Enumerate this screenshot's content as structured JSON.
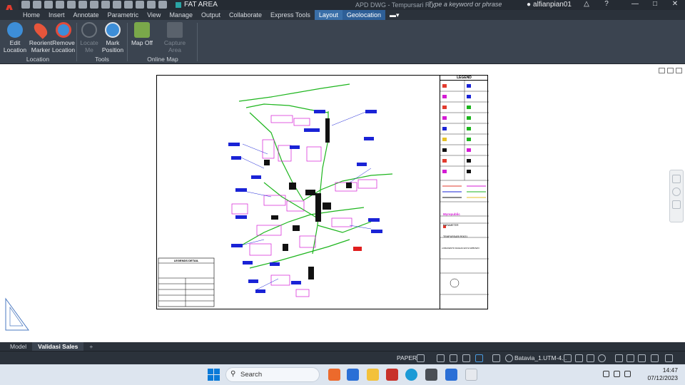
{
  "titlebar": {
    "app_logo": "A",
    "layer_name": "FAT AREA",
    "doc_title": "APD DWG - Tempursari R...",
    "search_placeholder": "Type a keyword or phrase",
    "user": "alfianpian01",
    "help": "?"
  },
  "menu": {
    "tabs": [
      "Home",
      "Insert",
      "Annotate",
      "Parametric",
      "View",
      "Manage",
      "Output",
      "Collaborate",
      "Express Tools",
      "Layout",
      "Geolocation"
    ],
    "active_tabs": [
      "Layout",
      "Geolocation"
    ]
  },
  "ribbon": {
    "groups": [
      {
        "label": "Location",
        "buttons": [
          {
            "label": "Edit\nLocation",
            "icon": "globe-pin-icon",
            "enabled": true
          },
          {
            "label": "Reorient\nMarker",
            "icon": "marker-move-icon",
            "enabled": true
          },
          {
            "label": "Remove\nLocation",
            "icon": "globe-remove-icon",
            "enabled": true
          }
        ]
      },
      {
        "label": "Tools",
        "buttons": [
          {
            "label": "Locate\nMe",
            "icon": "locate-me-icon",
            "enabled": false
          },
          {
            "label": "Mark\nPosition",
            "icon": "mark-position-icon",
            "enabled": true
          }
        ]
      },
      {
        "label": "Online Map",
        "buttons": [
          {
            "label": "Map Off",
            "icon": "map-off-icon",
            "enabled": true
          },
          {
            "label": "Capture\nArea",
            "icon": "capture-area-icon",
            "enabled": false
          }
        ]
      }
    ]
  },
  "drawing": {
    "legend_title": "LEGEND",
    "title_block_label": "PARAMETER",
    "company": "Myrepublic",
    "project": "TEMPURSARI R0021",
    "designer": "LORAVENTO RAIHAN ESYA WIBOWO",
    "table_header": "LEGENDS DETAIL"
  },
  "layout_tabs": [
    "Model",
    "Validasi Sales"
  ],
  "layout_tab_active": "Validasi Sales",
  "layout_tab_add": "+",
  "status": {
    "space": "PAPER",
    "coordinate_system": "Batavia_1.UTM-4..."
  },
  "taskbar": {
    "search_label": "Search",
    "time": "14:47",
    "date": "07/12/2023"
  },
  "colors": {
    "accent": "#3a6fa8",
    "autocad_red": "#e23b2e",
    "road_green": "#1db51d",
    "label_blue": "#1a23d6",
    "parcel_magenta": "#d41bd4"
  }
}
